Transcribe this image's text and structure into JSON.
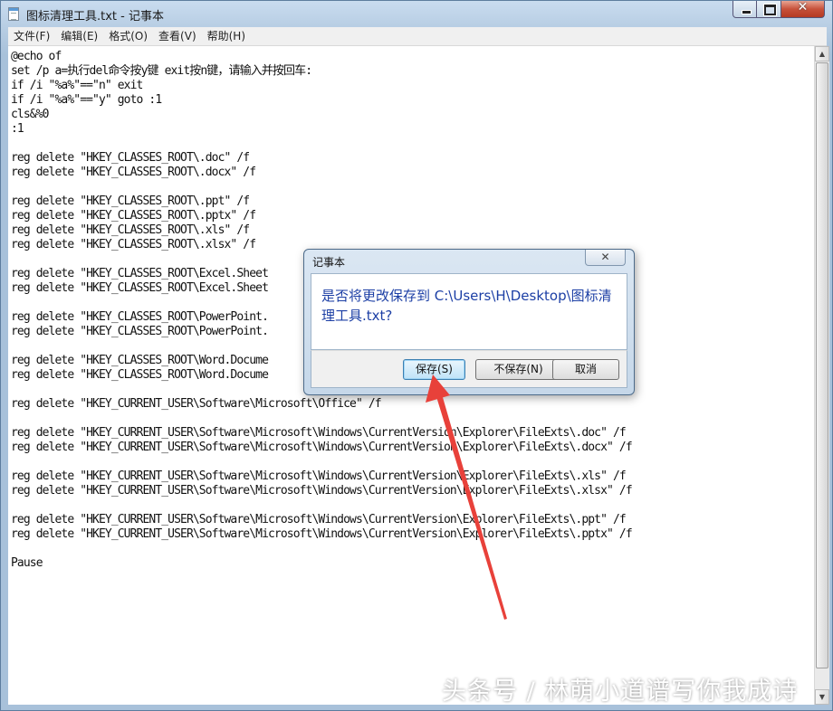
{
  "window": {
    "title": "图标清理工具.txt - 记事本",
    "icon": "notepad-icon",
    "buttons": {
      "minimize_icon": "minimize-icon",
      "maximize_icon": "maximize-icon",
      "close_glyph": "✕"
    }
  },
  "menu": {
    "items": [
      {
        "label": "文件(F)"
      },
      {
        "label": "编辑(E)"
      },
      {
        "label": "格式(O)"
      },
      {
        "label": "查看(V)"
      },
      {
        "label": "帮助(H)"
      }
    ]
  },
  "editor": {
    "content": "@echo of\nset /p a=执行del命令按y键 exit按n键，请输入并按回车:\nif /i \"%a%\"==\"n\" exit\nif /i \"%a%\"==\"y\" goto :1\ncls&%0\n:1\n\nreg delete \"HKEY_CLASSES_ROOT\\.doc\" /f\nreg delete \"HKEY_CLASSES_ROOT\\.docx\" /f\n\nreg delete \"HKEY_CLASSES_ROOT\\.ppt\" /f\nreg delete \"HKEY_CLASSES_ROOT\\.pptx\" /f\nreg delete \"HKEY_CLASSES_ROOT\\.xls\" /f\nreg delete \"HKEY_CLASSES_ROOT\\.xlsx\" /f\n\nreg delete \"HKEY_CLASSES_ROOT\\Excel.Sheet\nreg delete \"HKEY_CLASSES_ROOT\\Excel.Sheet\n\nreg delete \"HKEY_CLASSES_ROOT\\PowerPoint.\nreg delete \"HKEY_CLASSES_ROOT\\PowerPoint.\n\nreg delete \"HKEY_CLASSES_ROOT\\Word.Docume\nreg delete \"HKEY_CLASSES_ROOT\\Word.Docume\n\nreg delete \"HKEY_CURRENT_USER\\Software\\Microsoft\\Office\" /f\n\nreg delete \"HKEY_CURRENT_USER\\Software\\Microsoft\\Windows\\CurrentVersion\\Explorer\\FileExts\\.doc\" /f\nreg delete \"HKEY_CURRENT_USER\\Software\\Microsoft\\Windows\\CurrentVersion\\Explorer\\FileExts\\.docx\" /f\n\nreg delete \"HKEY_CURRENT_USER\\Software\\Microsoft\\Windows\\CurrentVersion\\Explorer\\FileExts\\.xls\" /f\nreg delete \"HKEY_CURRENT_USER\\Software\\Microsoft\\Windows\\CurrentVersion\\Explorer\\FileExts\\.xlsx\" /f\n\nreg delete \"HKEY_CURRENT_USER\\Software\\Microsoft\\Windows\\CurrentVersion\\Explorer\\FileExts\\.ppt\" /f\nreg delete \"HKEY_CURRENT_USER\\Software\\Microsoft\\Windows\\CurrentVersion\\Explorer\\FileExts\\.pptx\" /f\n\nPause"
  },
  "dialog": {
    "title": "记事本",
    "close_glyph": "✕",
    "message": "是否将更改保存到 C:\\Users\\H\\Desktop\\图标清理工具.txt?",
    "buttons": {
      "save": "保存(S)",
      "dont_save": "不保存(N)",
      "cancel": "取消"
    }
  },
  "annotation": {
    "arrow_color": "#e8413a"
  },
  "watermark": {
    "text": "头条号 / 林萌小道谱写你我成诗"
  }
}
